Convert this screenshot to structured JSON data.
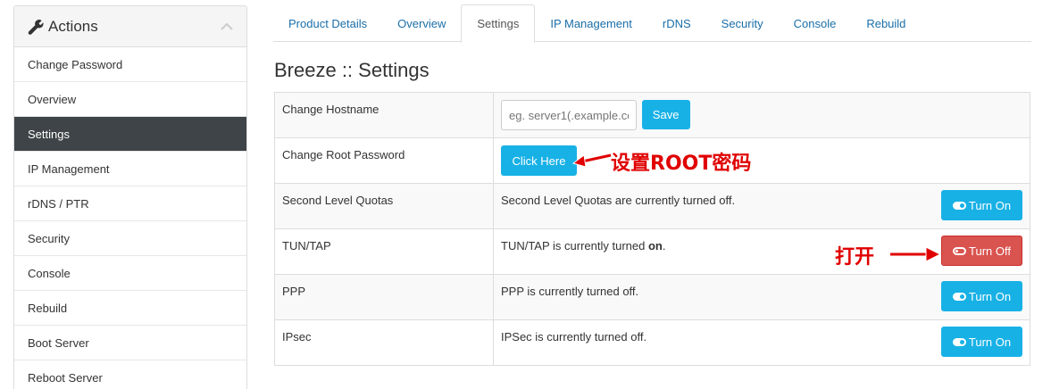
{
  "sidebar": {
    "title": "Actions",
    "items": [
      {
        "label": "Change Password"
      },
      {
        "label": "Overview"
      },
      {
        "label": "Settings"
      },
      {
        "label": "IP Management"
      },
      {
        "label": "rDNS / PTR"
      },
      {
        "label": "Security"
      },
      {
        "label": "Console"
      },
      {
        "label": "Rebuild"
      },
      {
        "label": "Boot Server"
      },
      {
        "label": "Reboot Server"
      }
    ],
    "active_item": "Settings"
  },
  "tabs": [
    {
      "label": "Product Details"
    },
    {
      "label": "Overview"
    },
    {
      "label": "Settings"
    },
    {
      "label": "IP Management"
    },
    {
      "label": "rDNS"
    },
    {
      "label": "Security"
    },
    {
      "label": "Console"
    },
    {
      "label": "Rebuild"
    }
  ],
  "active_tab": "Settings",
  "page_title": "Breeze :: Settings",
  "settings": {
    "hostname": {
      "label": "Change Hostname",
      "placeholder": "eg. server1(.example.com)",
      "save_label": "Save"
    },
    "root_password": {
      "label": "Change Root Password",
      "button_label": "Click Here"
    },
    "quotas": {
      "label": "Second Level Quotas",
      "status_text": "Second Level Quotas are currently turned off.",
      "button_label": "Turn On"
    },
    "tuntap": {
      "label": "TUN/TAP",
      "status_prefix": "TUN/TAP is currently turned ",
      "status_value": "on",
      "status_suffix": ".",
      "button_label": "Turn Off"
    },
    "ppp": {
      "label": "PPP",
      "status_text": "PPP is currently turned off.",
      "button_label": "Turn On"
    },
    "ipsec": {
      "label": "IPsec",
      "status_text": "IPSec is currently turned off.",
      "button_label": "Turn On"
    }
  },
  "annotations": {
    "root_password_note": "设置ROOT密码",
    "tuntap_note": "打开"
  },
  "colors": {
    "accent": "#18b1e6",
    "danger": "#d9534f",
    "sidebar_active": "#3e4447",
    "annotation": "#e00000"
  }
}
